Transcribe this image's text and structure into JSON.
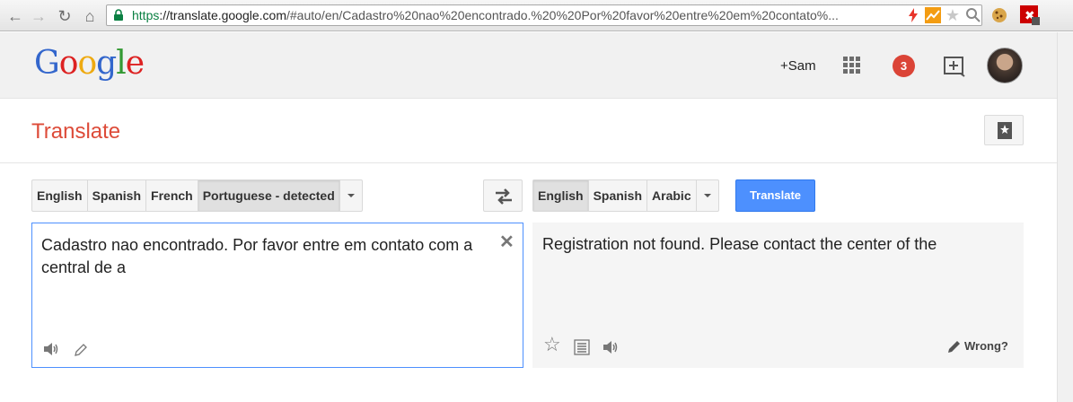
{
  "browser": {
    "url_secure": "https",
    "url_host": "://translate.google.com",
    "url_path": "/#auto/en/Cadastro%20nao%20encontrado.%20%20Por%20favor%20entre%20em%20contato%..."
  },
  "header": {
    "logo": [
      "G",
      "o",
      "o",
      "g",
      "l",
      "e"
    ],
    "plus_user": "+Sam",
    "notification_count": "3"
  },
  "page": {
    "title": "Translate"
  },
  "source_langs": {
    "items": [
      "English",
      "Spanish",
      "French",
      "Portuguese - detected"
    ],
    "selected": "Portuguese - detected"
  },
  "target_langs": {
    "items": [
      "English",
      "Spanish",
      "Arabic"
    ],
    "selected": "English"
  },
  "translate_button": "Translate",
  "source": {
    "text": "Cadastro nao encontrado.  Por favor entre em contato com a central de a"
  },
  "result": {
    "text": "Registration not found. Please contact the center of the",
    "wrong_label": "Wrong?"
  },
  "icons": {
    "back": "back-arrow-icon",
    "forward": "forward-arrow-icon",
    "reload": "reload-icon",
    "home": "home-icon",
    "lock": "lock-icon",
    "apps": "apps-grid-icon",
    "share": "share-icon",
    "bookmark": "phrasebook-icon",
    "swap": "swap-languages-icon",
    "clear": "clear-icon",
    "listen": "speaker-icon",
    "handwrite": "pencil-icon",
    "star": "star-icon",
    "list": "list-icon",
    "wrong": "pencil-icon"
  },
  "colors": {
    "translate_red": "#dd4b39",
    "button_blue": "#4d90fe",
    "notif_red": "#db4437",
    "secure_green": "#0b8043"
  }
}
